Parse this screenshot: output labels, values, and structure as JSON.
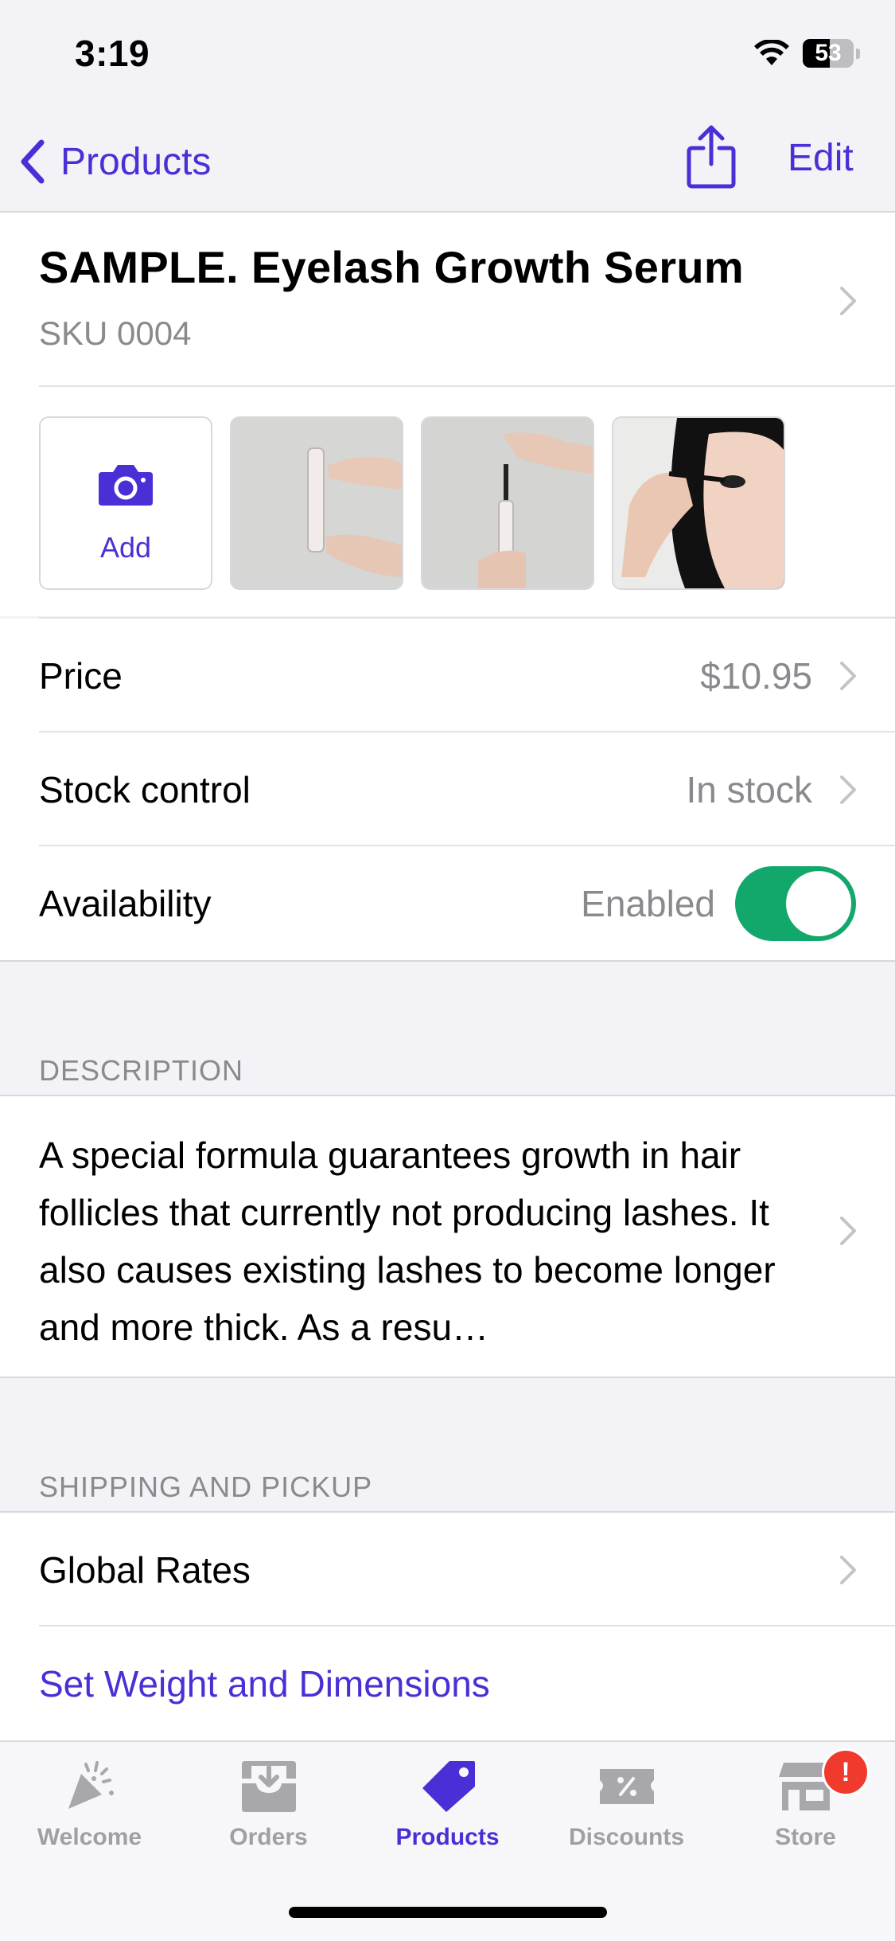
{
  "status_bar": {
    "time": "3:19",
    "battery": "53",
    "battery_level": 0.53
  },
  "nav": {
    "back_label": "Products",
    "edit_label": "Edit",
    "share_icon": "share-icon"
  },
  "product": {
    "title": "SAMPLE. Eyelash Growth Serum",
    "sku": "SKU 0004"
  },
  "photos": {
    "add_label": "Add",
    "add_icon": "camera-icon"
  },
  "details": {
    "price_label": "Price",
    "price_value": "$10.95",
    "stock_label": "Stock control",
    "stock_value": "In stock",
    "availability_label": "Availability",
    "availability_value": "Enabled",
    "availability_on": true
  },
  "description": {
    "header": "DESCRIPTION",
    "text": "A special formula guarantees growth in hair follicles that currently not producing lashes. It also causes existing lashes to become longer and more thick. As a resu…"
  },
  "shipping": {
    "header": "SHIPPING AND PICKUP",
    "global_rates": "Global Rates",
    "weight_link": "Set Weight and Dimensions"
  },
  "tabbar": {
    "tabs": [
      {
        "label": "Welcome",
        "icon": "party-popper-icon"
      },
      {
        "label": "Orders",
        "icon": "inbox-tray-icon"
      },
      {
        "label": "Products",
        "icon": "price-tag-icon"
      },
      {
        "label": "Discounts",
        "icon": "coupon-icon"
      },
      {
        "label": "Store",
        "icon": "storefront-icon"
      }
    ],
    "active": "Products",
    "store_badge": "!"
  },
  "colors": {
    "accent": "#4b2fd6",
    "toggle_on": "#13a86b",
    "badge": "#f03a2e"
  }
}
